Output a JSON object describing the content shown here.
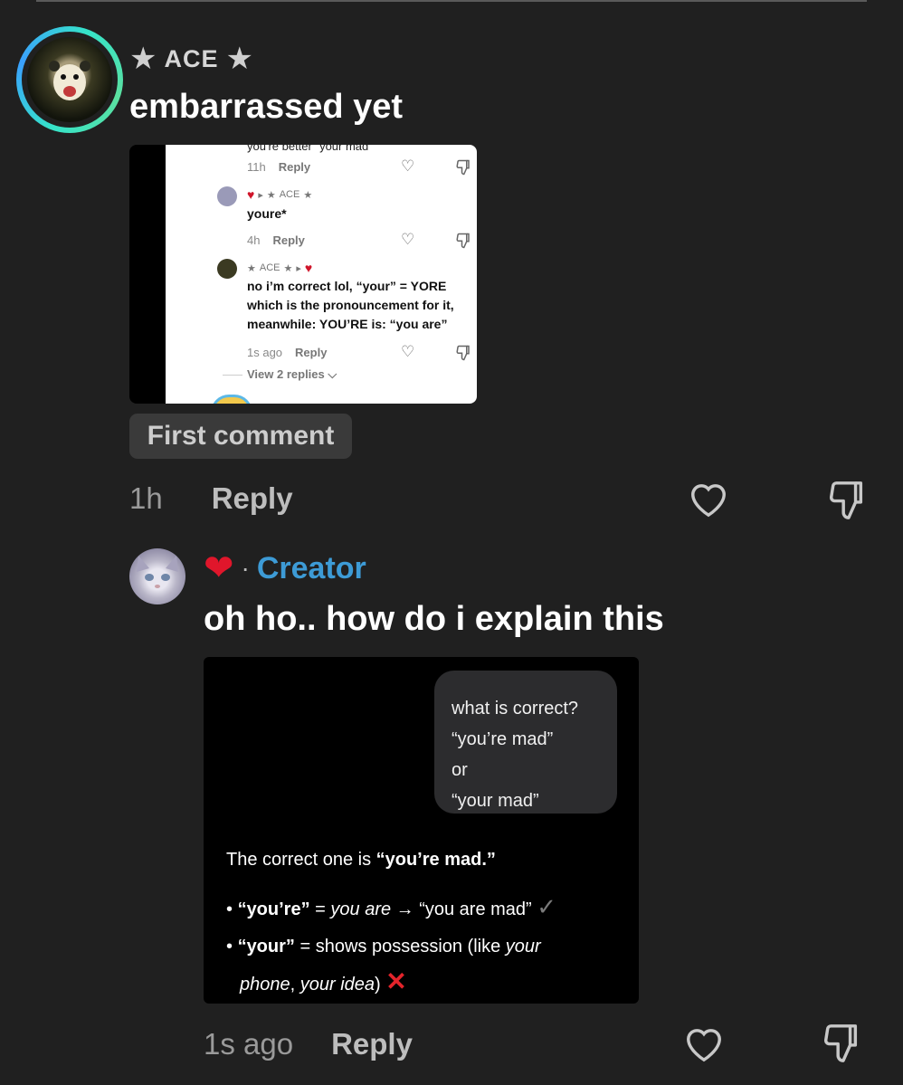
{
  "comment": {
    "username": "ACE",
    "text": "embarrassed yet",
    "badge": "First comment",
    "time": "1h",
    "reply_label": "Reply"
  },
  "screenshot": {
    "cut_text": "you're better \"your mad\"",
    "c1_time": "11h",
    "c1_reply": "Reply",
    "c2_user": "ACE",
    "c2_text": "youre*",
    "c2_time": "4h",
    "c2_reply": "Reply",
    "c3_user": "ACE",
    "c3_line1": "no i’m correct lol, “your” = YORE",
    "c3_line2": "which is the pronouncement for it,",
    "c3_line3": "meanwhile: YOU’RE is: “you are”",
    "c3_time": "1s ago",
    "c3_reply": "Reply",
    "view_replies": "View 2 replies"
  },
  "reply": {
    "creator_label": "Creator",
    "text": "oh ho.. how do i explain this",
    "time": "1s ago",
    "reply_label": "Reply"
  },
  "ai": {
    "q1": "what is correct?",
    "q2": "“you’re mad”",
    "q3": "or",
    "q4": "“your mad”",
    "answer_prefix": "The correct one is ",
    "answer_bold": "“you’re mad.”",
    "b1_term": "“you’re”",
    "b1_eq": " = ",
    "b1_ital": "you are",
    "b1_rest": " → “you are mad”",
    "b2_term": "“your”",
    "b2_rest": " = shows possession (like ",
    "b2_ital1": "your",
    "b2_ital2": "phone",
    "b2_comma": ", ",
    "b2_ital3": "your idea",
    "b2_close": ")"
  },
  "icons": {
    "star": "star-icon",
    "heart": "heart-outline-icon",
    "dislike": "thumbs-down-icon",
    "check": "check-icon",
    "cross": "cross-icon"
  },
  "colors": {
    "creator": "#3d9bd6",
    "heart": "#e0162b",
    "background": "#202020"
  }
}
